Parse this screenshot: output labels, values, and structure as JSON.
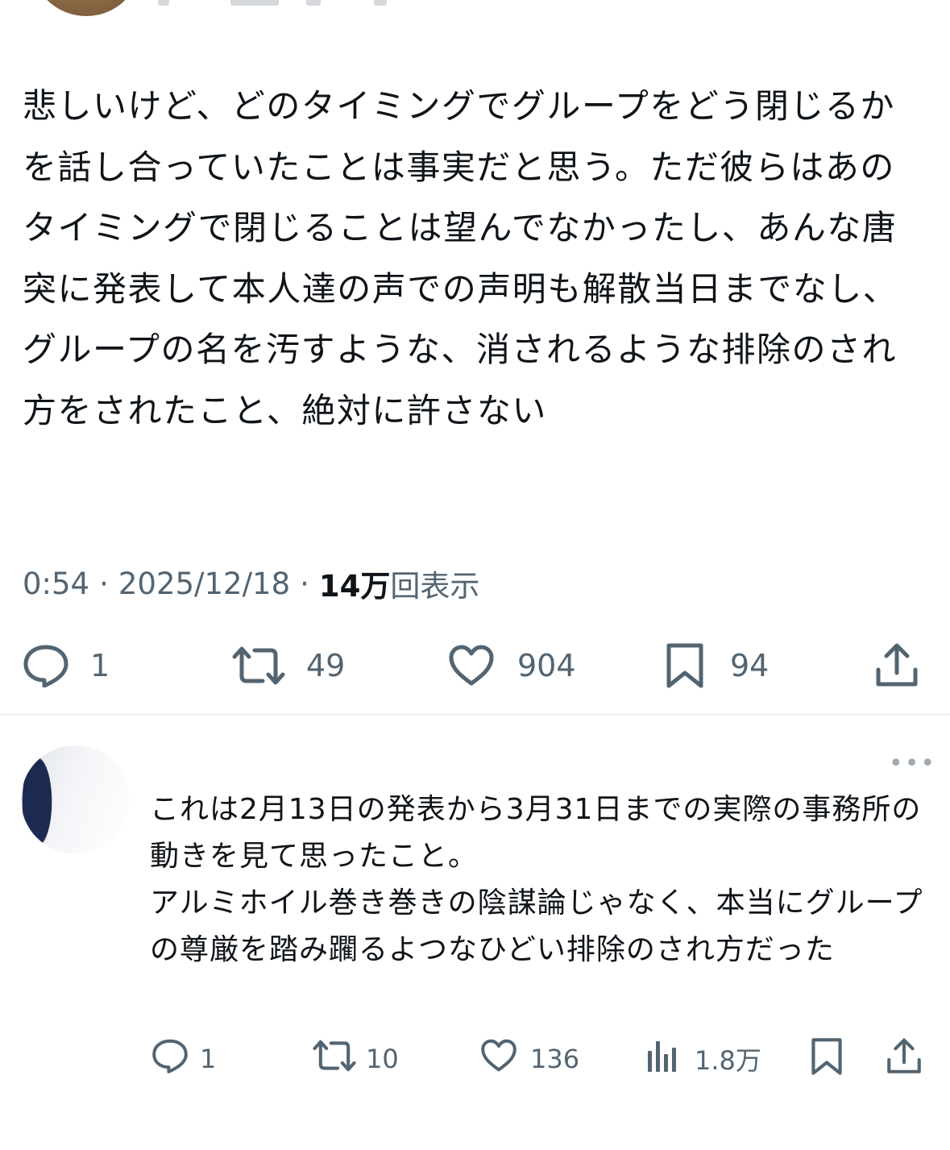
{
  "main_tweet": {
    "text": "悲しいけど、どのタイミングでグループをどう閉じるかを話し合っていたことは事実だと思う。ただ彼らはあのタイミングで閉じることは望んでなかったし、あんな唐突に発表して本人達の声での声明も解散当日までなし、グループの名を汚すような、消されるような排除のされ方をされたこと、絶対に許さない",
    "time": "0:54",
    "date": "2025/12/18",
    "views_count": "14万",
    "views_label": "回表示",
    "separator": "·",
    "replies": "1",
    "retweets": "49",
    "likes": "904",
    "bookmarks": "94"
  },
  "reply_tweet": {
    "text": "これは2月13日の発表から3月31日までの実際の事務所の動きを見て思ったこと。\nアルミホイル巻き巻きの陰謀論じゃなく、本当にグループの尊厳を踏み躙るよつなひどい排除のされ方だった",
    "replies": "1",
    "retweets": "10",
    "likes": "136",
    "views": "1.8万"
  },
  "icons": {
    "reply": "speech-bubble",
    "retweet": "retweet-arrows",
    "like": "heart",
    "bookmark": "bookmark",
    "share": "share-upload",
    "views": "bar-chart",
    "more": "more-dots"
  },
  "colors": {
    "text": "#0f1419",
    "secondary": "#536471",
    "divider": "#e7e9ea"
  }
}
